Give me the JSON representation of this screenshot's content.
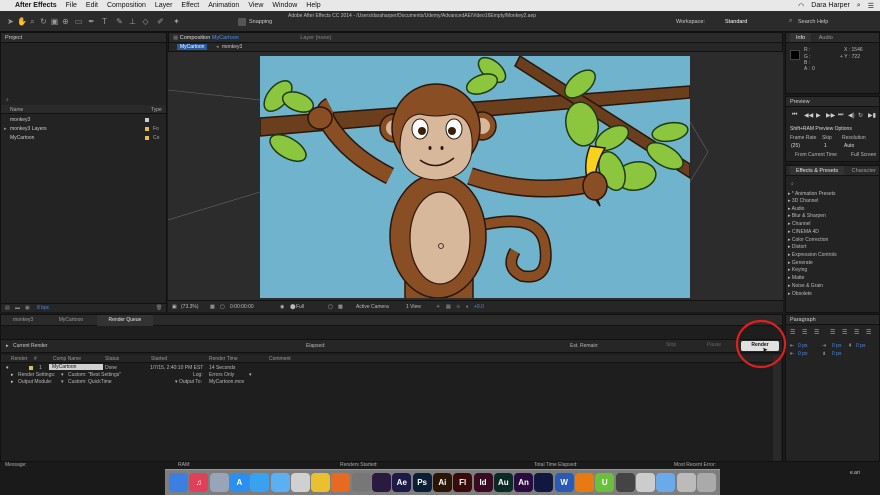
{
  "menubar": {
    "app_name": "After Effects",
    "items": [
      "File",
      "Edit",
      "Composition",
      "Layer",
      "Effect",
      "Animation",
      "View",
      "Window",
      "Help"
    ],
    "user": "Dara Harper"
  },
  "toolbar": {
    "snapping_label": "Snapping",
    "window_path": "Adobe After Effects CC 2014 - /Users/daraharper/Documents/Udemy/AdvancedAE/Video16Empty/Monkey2.aep",
    "workspace_label": "Workspace:",
    "workspace_value": "Standard",
    "search_placeholder": "Search Help"
  },
  "project_panel": {
    "title": "Project",
    "columns": {
      "name": "Name",
      "type": "Type"
    },
    "items": [
      {
        "name": "monkey3",
        "type": ""
      },
      {
        "name": "monkey3 Layers",
        "type": "Fo"
      },
      {
        "name": "MyCartoon",
        "type": "Co"
      }
    ],
    "bpc": "8 bpc"
  },
  "comp_panel": {
    "title": "Composition",
    "comp_name": "MyCartoon",
    "layer_label": "Layer (none)",
    "tabs": [
      "MyCartoon",
      "monkey3"
    ]
  },
  "viewer": {
    "zoom": "(73.3%)",
    "timecode": "0:00:00:00",
    "resolution": "Full",
    "camera": "Active Camera",
    "views": "1 View",
    "offset": "+0.0"
  },
  "info_panel": {
    "tabs": [
      "Info",
      "Audio"
    ],
    "r": "R :",
    "g": "G :",
    "b": "B :",
    "a_label": "A :",
    "a_value": "0",
    "x": "X : 1546",
    "y": "+ Y : 722"
  },
  "preview_panel": {
    "title": "Preview",
    "ram_options": "Shift+RAM Preview Options",
    "frame_rate_label": "Frame Rate",
    "skip_label": "Skip",
    "resolution_label": "Resolution",
    "frame_rate_value": "(25)",
    "skip_value": "1",
    "resolution_value": "Auto",
    "from_current": "From Current Time",
    "full_screen": "Full Screen"
  },
  "effects_panel": {
    "tabs": [
      "Effects & Presets",
      "Character"
    ],
    "items": [
      "* Animation Presets",
      "3D Channel",
      "Audio",
      "Blur & Sharpen",
      "Channel",
      "CINEMA 4D",
      "Color Correction",
      "Distort",
      "Expression Controls",
      "Generate",
      "Keying",
      "Matte",
      "Noise & Grain",
      "Obsolete"
    ]
  },
  "paragraph_panel": {
    "title": "Paragraph",
    "px_values": [
      "0 px",
      "0 px",
      "0 px",
      "0 px",
      "0 px"
    ]
  },
  "bottom_tabs": [
    "monkey3",
    "MyCartoon",
    "Render Queue"
  ],
  "render_queue": {
    "current_render": "Current Render",
    "elapsed": "Elapsed:",
    "est_remain": "Est. Remain:",
    "stop": "Stop",
    "pause": "Pause",
    "render": "Render",
    "columns": [
      "Render",
      "#",
      "Comp Name",
      "Status",
      "Started",
      "Render Time",
      "Comment"
    ],
    "item": {
      "number": "1",
      "comp_name": "MyCartoon",
      "status": "Done",
      "started": "1/7/15, 2:40:10 PM EST",
      "render_time": "14 Seconds"
    },
    "render_settings_label": "Render Settings:",
    "render_settings_value": "Custom: \"Best Settings\"",
    "log_label": "Log:",
    "log_value": "Errors Only",
    "output_module_label": "Output Module:",
    "output_module_value": "Custom: QuickTime",
    "output_to_label": "Output To:",
    "output_to_value": "MyCartoon.mov"
  },
  "status_bar": {
    "message": "Message:",
    "ram": "RAM:",
    "renders_started": "Renders Started:",
    "total_time": "Total Time Elapsed:",
    "recent_error": "Most Recent Error:"
  },
  "watermark": "e.ari",
  "dock": {
    "icons": [
      {
        "name": "finder-icon",
        "label": "",
        "color": "#3d7fe0"
      },
      {
        "name": "music-icon",
        "label": "♫",
        "color": "#e0405a"
      },
      {
        "name": "launchpad-icon",
        "label": "",
        "color": "#9aa4b8"
      },
      {
        "name": "appstore-icon",
        "label": "A",
        "color": "#2a8ff0"
      },
      {
        "name": "safari-icon",
        "label": "",
        "color": "#3aa0f0"
      },
      {
        "name": "mail-icon",
        "label": "",
        "color": "#5ab0f0"
      },
      {
        "name": "photos-icon",
        "label": "",
        "color": "#d0d0d0"
      },
      {
        "name": "chrome-icon",
        "label": "",
        "color": "#e8c030"
      },
      {
        "name": "firefox-icon",
        "label": "",
        "color": "#e86a20"
      },
      {
        "name": "settings-icon",
        "label": "",
        "color": "#777"
      },
      {
        "name": "premiere-icon",
        "label": "",
        "color": "#2a1a40"
      },
      {
        "name": "after-effects-icon",
        "label": "Ae",
        "color": "#1e1a48"
      },
      {
        "name": "photoshop-icon",
        "label": "Ps",
        "color": "#0a1e36"
      },
      {
        "name": "illustrator-icon",
        "label": "Ai",
        "color": "#2a1404"
      },
      {
        "name": "flash-icon",
        "label": "Fl",
        "color": "#3a0a0a"
      },
      {
        "name": "indesign-icon",
        "label": "Id",
        "color": "#3a0a22"
      },
      {
        "name": "audition-icon",
        "label": "Au",
        "color": "#0a2a26"
      },
      {
        "name": "animate-icon",
        "label": "An",
        "color": "#2a0a40"
      },
      {
        "name": "encoder-icon",
        "label": "",
        "color": "#101840"
      },
      {
        "name": "word-icon",
        "label": "W",
        "color": "#2a5ab8"
      },
      {
        "name": "vlc-icon",
        "label": "",
        "color": "#e87a10"
      },
      {
        "name": "upwork-icon",
        "label": "U",
        "color": "#6ac03a"
      },
      {
        "name": "app-icon",
        "label": "",
        "color": "#444"
      },
      {
        "name": "preview-icon",
        "label": "",
        "color": "#ccc"
      },
      {
        "name": "folder-icon",
        "label": "",
        "color": "#6aaae8"
      },
      {
        "name": "finder-window-icon",
        "label": "",
        "color": "#bbb"
      },
      {
        "name": "trash-icon",
        "label": "",
        "color": "#aaa"
      }
    ]
  },
  "colors": {
    "accent_blue": "#4a8ef0",
    "canvas_background": "#6fb3cd",
    "highlight_red": "#e02020"
  }
}
